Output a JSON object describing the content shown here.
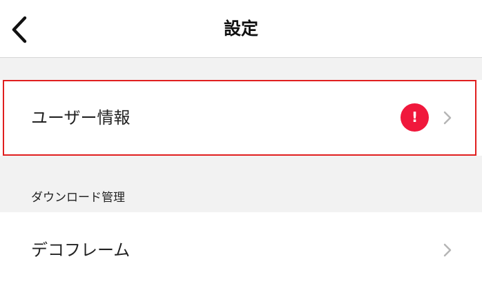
{
  "header": {
    "title": "設定",
    "back_icon": "chevron-left-icon"
  },
  "rows": [
    {
      "label": "ユーザー情報",
      "badge": "!",
      "badge_color": "#f0183c",
      "highlight_color": "#e01e1e",
      "chevron_icon": "chevron-right-icon"
    }
  ],
  "section": {
    "label": "ダウンロード管理"
  },
  "section_rows": [
    {
      "label": "デコフレーム",
      "chevron_icon": "chevron-right-icon"
    }
  ]
}
